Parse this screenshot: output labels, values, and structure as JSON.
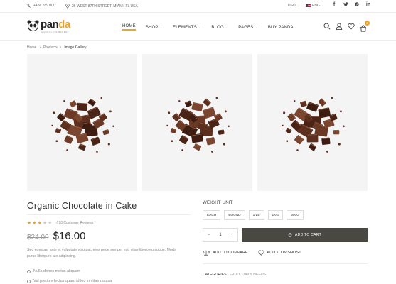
{
  "topbar": {
    "phone": "+456 789 000",
    "address": "26 WEST 87TH STREET, MIAMI, FL USA",
    "currency": "USD",
    "language": "ENG",
    "social": [
      "f",
      "t",
      "p",
      "in"
    ]
  },
  "brand": {
    "logo_main": "pan",
    "logo_accent": "da",
    "logo_tagline": "CHOCOLATE BAKERY"
  },
  "nav": [
    {
      "label": "HOME",
      "active": true,
      "dropdown": false
    },
    {
      "label": "SHOP",
      "active": false,
      "dropdown": true
    },
    {
      "label": "ELEMENTS",
      "active": false,
      "dropdown": true
    },
    {
      "label": "BLOG",
      "active": false,
      "dropdown": true
    },
    {
      "label": "PAGES",
      "active": false,
      "dropdown": true
    },
    {
      "label": "BUY PANDA!",
      "active": false,
      "dropdown": false
    }
  ],
  "header_icons": [
    "search-icon",
    "user-icon",
    "heart-icon",
    "cart-icon"
  ],
  "cart_count": "0",
  "breadcrumb": [
    "Home",
    "Products",
    "Image Gallery"
  ],
  "gallery_count": 3,
  "product": {
    "title": "Organic Chocolate in Cake",
    "rating": 3,
    "rating_max": 5,
    "reviews": "( 10 Customer Reviews )",
    "old_price": "$24.00",
    "price": "$16.00",
    "description": "Sed egestas, ante et vulputate volutpat, eros pede semper est, vitae libero eu augue. Morbi purus liberpuro ate adipiscing.",
    "bullets": [
      "Nulla donec metus aliquam",
      "Vel pretium lectus quam id leo in vitae massa"
    ]
  },
  "options": {
    "label": "WEIGHT UNIT",
    "values": [
      "EACH",
      "BOUND",
      "1 LB",
      "1KG",
      "500G"
    ]
  },
  "cart": {
    "qty": "1",
    "minus": "−",
    "plus": "+",
    "add_label": "ADD TO CART"
  },
  "actions": {
    "compare": "ADD TO COMPARE",
    "wishlist": "ADD TO WISHLIST"
  },
  "categories": {
    "label": "CATEGORIES",
    "value": "FRUIT, DAILY NEEDS"
  },
  "colors": {
    "accent": "#e8a333",
    "button": "#4a4843",
    "chocolate": "#5c2f1f"
  }
}
